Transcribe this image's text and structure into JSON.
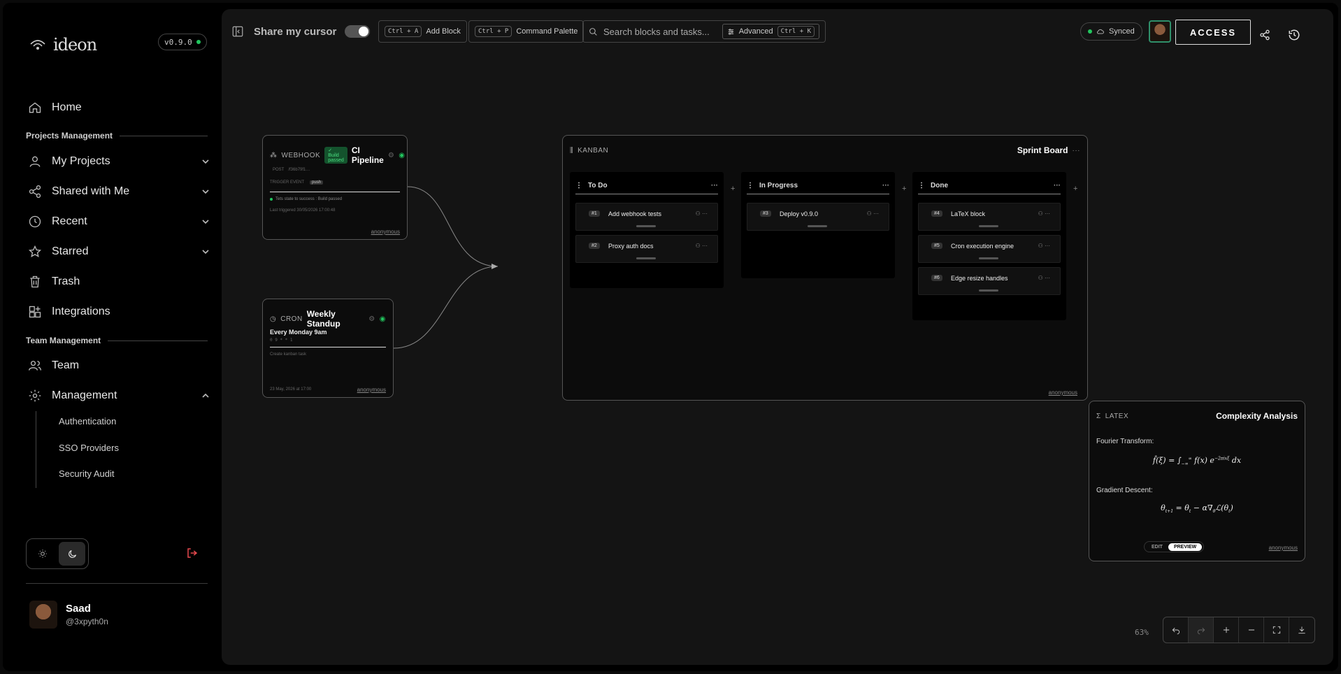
{
  "app": {
    "name": "ideon",
    "version": "v0.9.0"
  },
  "sidebar": {
    "items": [
      {
        "label": "Home",
        "icon": "home-icon"
      },
      {
        "label": "My Projects",
        "icon": "user-icon"
      },
      {
        "label": "Shared with Me",
        "icon": "share-icon"
      },
      {
        "label": "Recent",
        "icon": "clock-icon"
      },
      {
        "label": "Starred",
        "icon": "star-icon"
      },
      {
        "label": "Trash",
        "icon": "trash-icon"
      },
      {
        "label": "Integrations",
        "icon": "integrations-icon"
      },
      {
        "label": "Team",
        "icon": "team-icon"
      },
      {
        "label": "Management",
        "icon": "gear-icon"
      }
    ],
    "sections": {
      "projects": "Projects Management",
      "team": "Team Management"
    },
    "management_sub": [
      "Authentication",
      "SSO Providers",
      "Security Audit"
    ],
    "user": {
      "name": "Saad",
      "handle": "@3xpyth0n"
    }
  },
  "toolbar": {
    "share_cursor": "Share my cursor",
    "add_block_kbd": "Ctrl + A",
    "add_block": "Add Block",
    "palette_kbd": "Ctrl + P",
    "palette": "Command Palette",
    "search_placeholder": "Search blocks and tasks...",
    "advanced": "Advanced",
    "advanced_kbd": "Ctrl + K",
    "synced": "Synced",
    "access": "ACCESS"
  },
  "webhook": {
    "type": "WEBHOOK",
    "badge": "✓ Build passed",
    "title": "CI Pipeline",
    "method": "POST",
    "path": "/f36b79f1…",
    "trigger_label": "TRIGGER EVENT",
    "trigger_value": "push",
    "status": "Tets state to success : Build passed",
    "last": "Last triggered 30/05/2026 17:00:48",
    "owner": "anonymous"
  },
  "cron": {
    "type": "CRON",
    "title": "Weekly Standup",
    "schedule": "Every Monday 9am",
    "expr": "0 9 * * 1",
    "action": "Create kanban task",
    "date": "23 May, 2026 at 17:00",
    "owner": "anonymous"
  },
  "kanban": {
    "type": "KANBAN",
    "title": "Sprint Board",
    "owner": "anonymous",
    "columns": [
      {
        "name": "To Do",
        "cards": [
          {
            "id": "#1",
            "title": "Add webhook tests"
          },
          {
            "id": "#2",
            "title": "Proxy auth docs"
          }
        ]
      },
      {
        "name": "In Progress",
        "cards": [
          {
            "id": "#3",
            "title": "Deploy v0.9.0"
          }
        ]
      },
      {
        "name": "Done",
        "cards": [
          {
            "id": "#4",
            "title": "LaTeX block"
          },
          {
            "id": "#5",
            "title": "Cron execution engine"
          },
          {
            "id": "#6",
            "title": "Edge resize handles"
          }
        ]
      }
    ]
  },
  "latex": {
    "type": "LATEX",
    "title": "Complexity Analysis",
    "label1": "Fourier Transform:",
    "label2": "Gradient Descent:",
    "edit": "EDIT",
    "preview": "PREVIEW",
    "owner": "anonymous"
  },
  "zoom": {
    "level": "63%"
  },
  "colors": {
    "accent_green": "#22c55e",
    "canvas_bg": "#141414"
  }
}
